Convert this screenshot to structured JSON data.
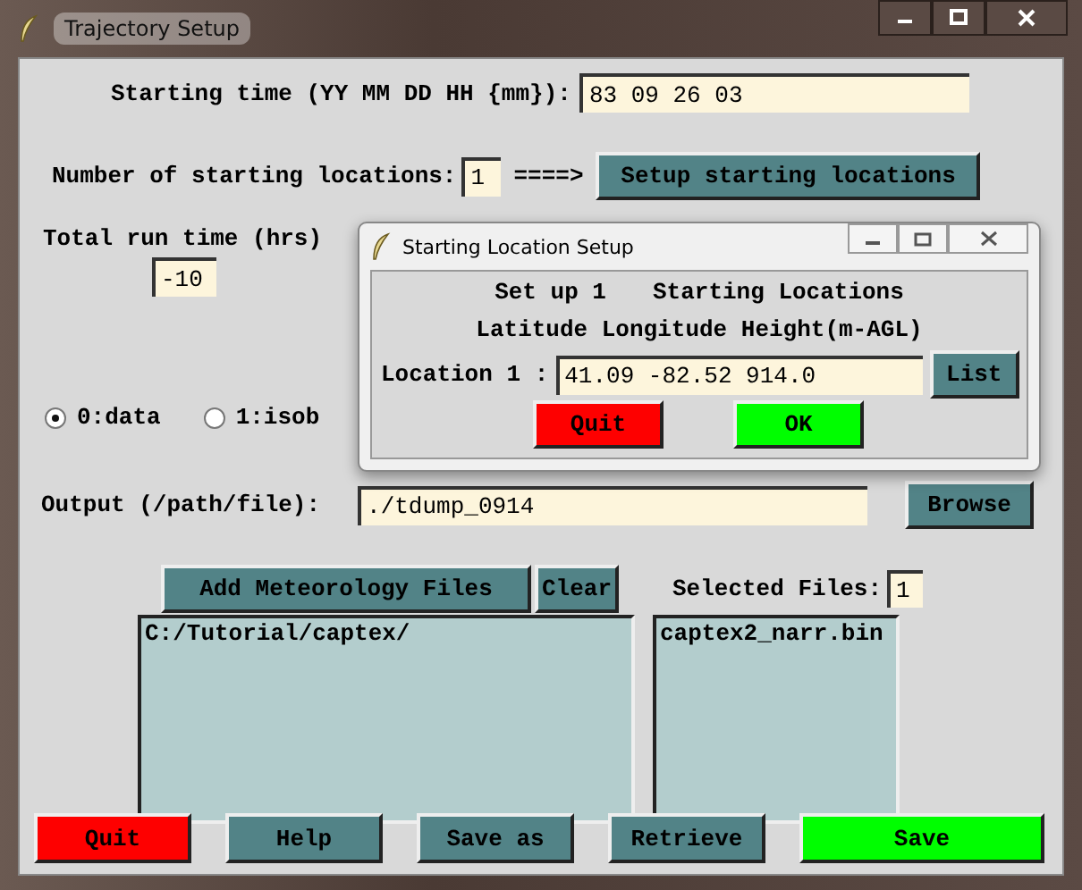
{
  "window": {
    "title": "Trajectory Setup"
  },
  "starting_time": {
    "label": "Starting time (YY MM DD HH {mm}):",
    "value": "83 09 26 03"
  },
  "locations": {
    "label": "Number of starting locations:",
    "value": "1",
    "arrow": "====>",
    "button": "Setup starting locations"
  },
  "run_time": {
    "label": "Total run time (hrs)",
    "value": "-10"
  },
  "vertical_motion": [
    {
      "label": "0:data",
      "selected": true
    },
    {
      "label": "1:isob",
      "selected": false
    }
  ],
  "output": {
    "label": "Output (/path/file):",
    "value": "./tdump_0914",
    "button": "Browse"
  },
  "meteorology": {
    "add_button": "Add Meteorology Files",
    "clear_button": "Clear",
    "selected_label": "Selected Files:",
    "selected_count": "1",
    "directories": [
      "C:/Tutorial/captex/"
    ],
    "files": [
      "captex2_narr.bin"
    ]
  },
  "buttons": [
    {
      "label": "Quit",
      "kind": "quit"
    },
    {
      "label": "Help",
      "kind": "plain"
    },
    {
      "label": "Save as",
      "kind": "plain"
    },
    {
      "label": "Retrieve",
      "kind": "plain"
    },
    {
      "label": "Save",
      "kind": "save"
    }
  ],
  "dialog": {
    "title": "Starting Location Setup",
    "heading_1": "Set up 1",
    "heading_2": "Starting Locations",
    "columns": "Latitude Longitude Height(m-AGL)",
    "location_label": "Location 1 :",
    "location_value": "41.09 -82.52 914.0",
    "list_button": "List",
    "quit_button": "Quit",
    "ok_button": "OK"
  }
}
